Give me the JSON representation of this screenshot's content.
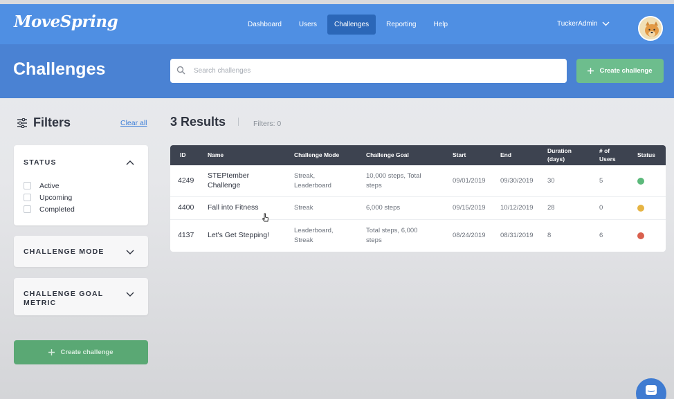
{
  "brand": {
    "logo_text": "MoveSpring"
  },
  "nav": {
    "items": [
      {
        "label": "Dashboard",
        "active": false
      },
      {
        "label": "Users",
        "active": false
      },
      {
        "label": "Challenges",
        "active": true
      },
      {
        "label": "Reporting",
        "active": false
      },
      {
        "label": "Help",
        "active": false
      }
    ],
    "user_name": "TuckerAdmin"
  },
  "header": {
    "title": "Challenges",
    "search_placeholder": "Search challenges",
    "create_label": "Create challenge"
  },
  "filters": {
    "title": "Filters",
    "clear_label": "Clear all",
    "status": {
      "title": "STATUS",
      "options": [
        {
          "label": "Active",
          "checked": false
        },
        {
          "label": "Upcoming",
          "checked": false
        },
        {
          "label": "Completed",
          "checked": false
        }
      ]
    },
    "mode_title": "CHALLENGE MODE",
    "goal_title_line1": "CHALLENGE GOAL",
    "goal_title_line2": "METRIC",
    "create_label": "Create challenge"
  },
  "results": {
    "title": "3 Results",
    "filters_count": "Filters: 0"
  },
  "table": {
    "columns": {
      "id": "ID",
      "name": "Name",
      "mode": "Challenge Mode",
      "goal": "Challenge Goal",
      "start": "Start",
      "end": "End",
      "duration_l1": "Duration",
      "duration_l2": "(days)",
      "users_l1": "# of",
      "users_l2": "Users",
      "status": "Status"
    },
    "rows": [
      {
        "id": "4249",
        "name_l1": "STEPtember",
        "name_l2": "Challenge",
        "mode_l1": "Streak,",
        "mode_l2": "Leaderboard",
        "goal_l1": "10,000 steps, Total",
        "goal_l2": "steps",
        "start": "09/01/2019",
        "end": "09/30/2019",
        "duration": "30",
        "users": "5",
        "status_color": "#5cb97b"
      },
      {
        "id": "4400",
        "name_l1": "Fall into Fitness",
        "name_l2": "",
        "mode_l1": "Streak",
        "mode_l2": "",
        "goal_l1": "6,000 steps",
        "goal_l2": "",
        "start": "09/15/2019",
        "end": "10/12/2019",
        "duration": "28",
        "users": "0",
        "status_color": "#e6b443"
      },
      {
        "id": "4137",
        "name_l1": "Let's Get Stepping!",
        "name_l2": "",
        "mode_l1": "Leaderboard,",
        "mode_l2": "Streak",
        "goal_l1": "Total steps, 6,000",
        "goal_l2": "steps",
        "start": "08/24/2019",
        "end": "08/31/2019",
        "duration": "8",
        "users": "6",
        "status_color": "#d9604e"
      }
    ]
  },
  "colors": {
    "nav_bg": "#4f8fe3",
    "hero_bg": "#4a82d3",
    "accent_green": "#6dbd8d",
    "table_header": "#3d4350"
  },
  "icons": [
    "search-icon",
    "filter-sliders-icon",
    "chevron-up-icon",
    "chevron-down-icon",
    "plus-icon",
    "avatar-dog-icon",
    "chat-icon"
  ]
}
